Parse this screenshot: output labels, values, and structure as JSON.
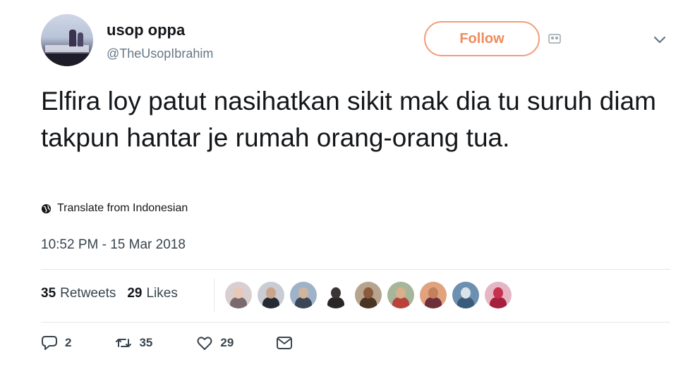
{
  "user": {
    "display_name": "usop oppa",
    "handle": "@TheUsopIbrahim"
  },
  "follow_button": {
    "label": "Follow"
  },
  "tweet": {
    "text": "Elfira loy patut nasihatkan sikit mak dia tu suruh diam takpun hantar je rumah orang-orang tua.",
    "translate_label": "Translate from Indonesian",
    "timestamp": "10:52 PM - 15 Mar 2018"
  },
  "stats": {
    "retweets_count": "35",
    "retweets_label": "Retweets",
    "likes_count": "29",
    "likes_label": "Likes"
  },
  "likers": [
    {
      "icon": "avatar",
      "bg": "#d9cfd0",
      "face": "#e8c9b8",
      "body": "#7a6a6e"
    },
    {
      "icon": "avatar",
      "bg": "#c9ccd3",
      "face": "#caa58c",
      "body": "#262a33"
    },
    {
      "icon": "avatar",
      "bg": "#9fb3c8",
      "face": "#d1b59a",
      "body": "#3c4656"
    },
    {
      "icon": "avatar",
      "bg": "#ffffff",
      "face": "#3b3535",
      "body": "#2b2626"
    },
    {
      "icon": "avatar",
      "bg": "#b7a48f",
      "face": "#8a5a3c",
      "body": "#4a3424"
    },
    {
      "icon": "avatar",
      "bg": "#a7b59a",
      "face": "#d8b08e",
      "body": "#b8433a"
    },
    {
      "icon": "avatar",
      "bg": "#e0a37e",
      "face": "#c47f5c",
      "body": "#6e2f3a"
    },
    {
      "icon": "avatar",
      "bg": "#6d8fb0",
      "face": "#d9e2ea",
      "body": "#3b5b7a"
    },
    {
      "icon": "avatar",
      "bg": "#e5b7c4",
      "face": "#c8324e",
      "body": "#a5203c"
    }
  ],
  "actions": {
    "reply_count": "2",
    "retweet_count": "35",
    "like_count": "29"
  },
  "colors": {
    "follow_accent": "#f08a5d",
    "text": "#14171a",
    "secondary_text": "#657786"
  }
}
